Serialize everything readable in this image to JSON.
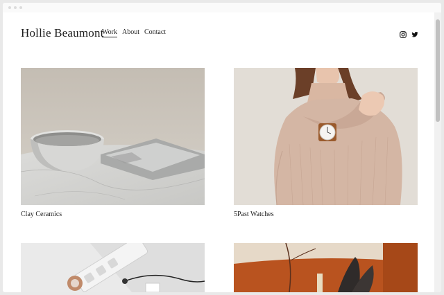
{
  "site": {
    "title": "Hollie Beaumont",
    "nav": [
      {
        "label": "Work",
        "active": true
      },
      {
        "label": "About",
        "active": false
      },
      {
        "label": "Contact",
        "active": false
      }
    ],
    "social": [
      {
        "icon": "instagram-icon"
      },
      {
        "icon": "twitter-icon"
      }
    ]
  },
  "projects": [
    {
      "caption": "Clay Ceramics",
      "image": "ceramic-bowl-on-marble"
    },
    {
      "caption": "5Past Watches",
      "image": "woman-wearing-watch"
    },
    {
      "caption": "",
      "image": "power-strip-cable"
    },
    {
      "caption": "",
      "image": "orange-still-life"
    }
  ],
  "colors": {
    "background": "#ffffff",
    "text": "#222222",
    "accent_orange": "#b9531f"
  }
}
